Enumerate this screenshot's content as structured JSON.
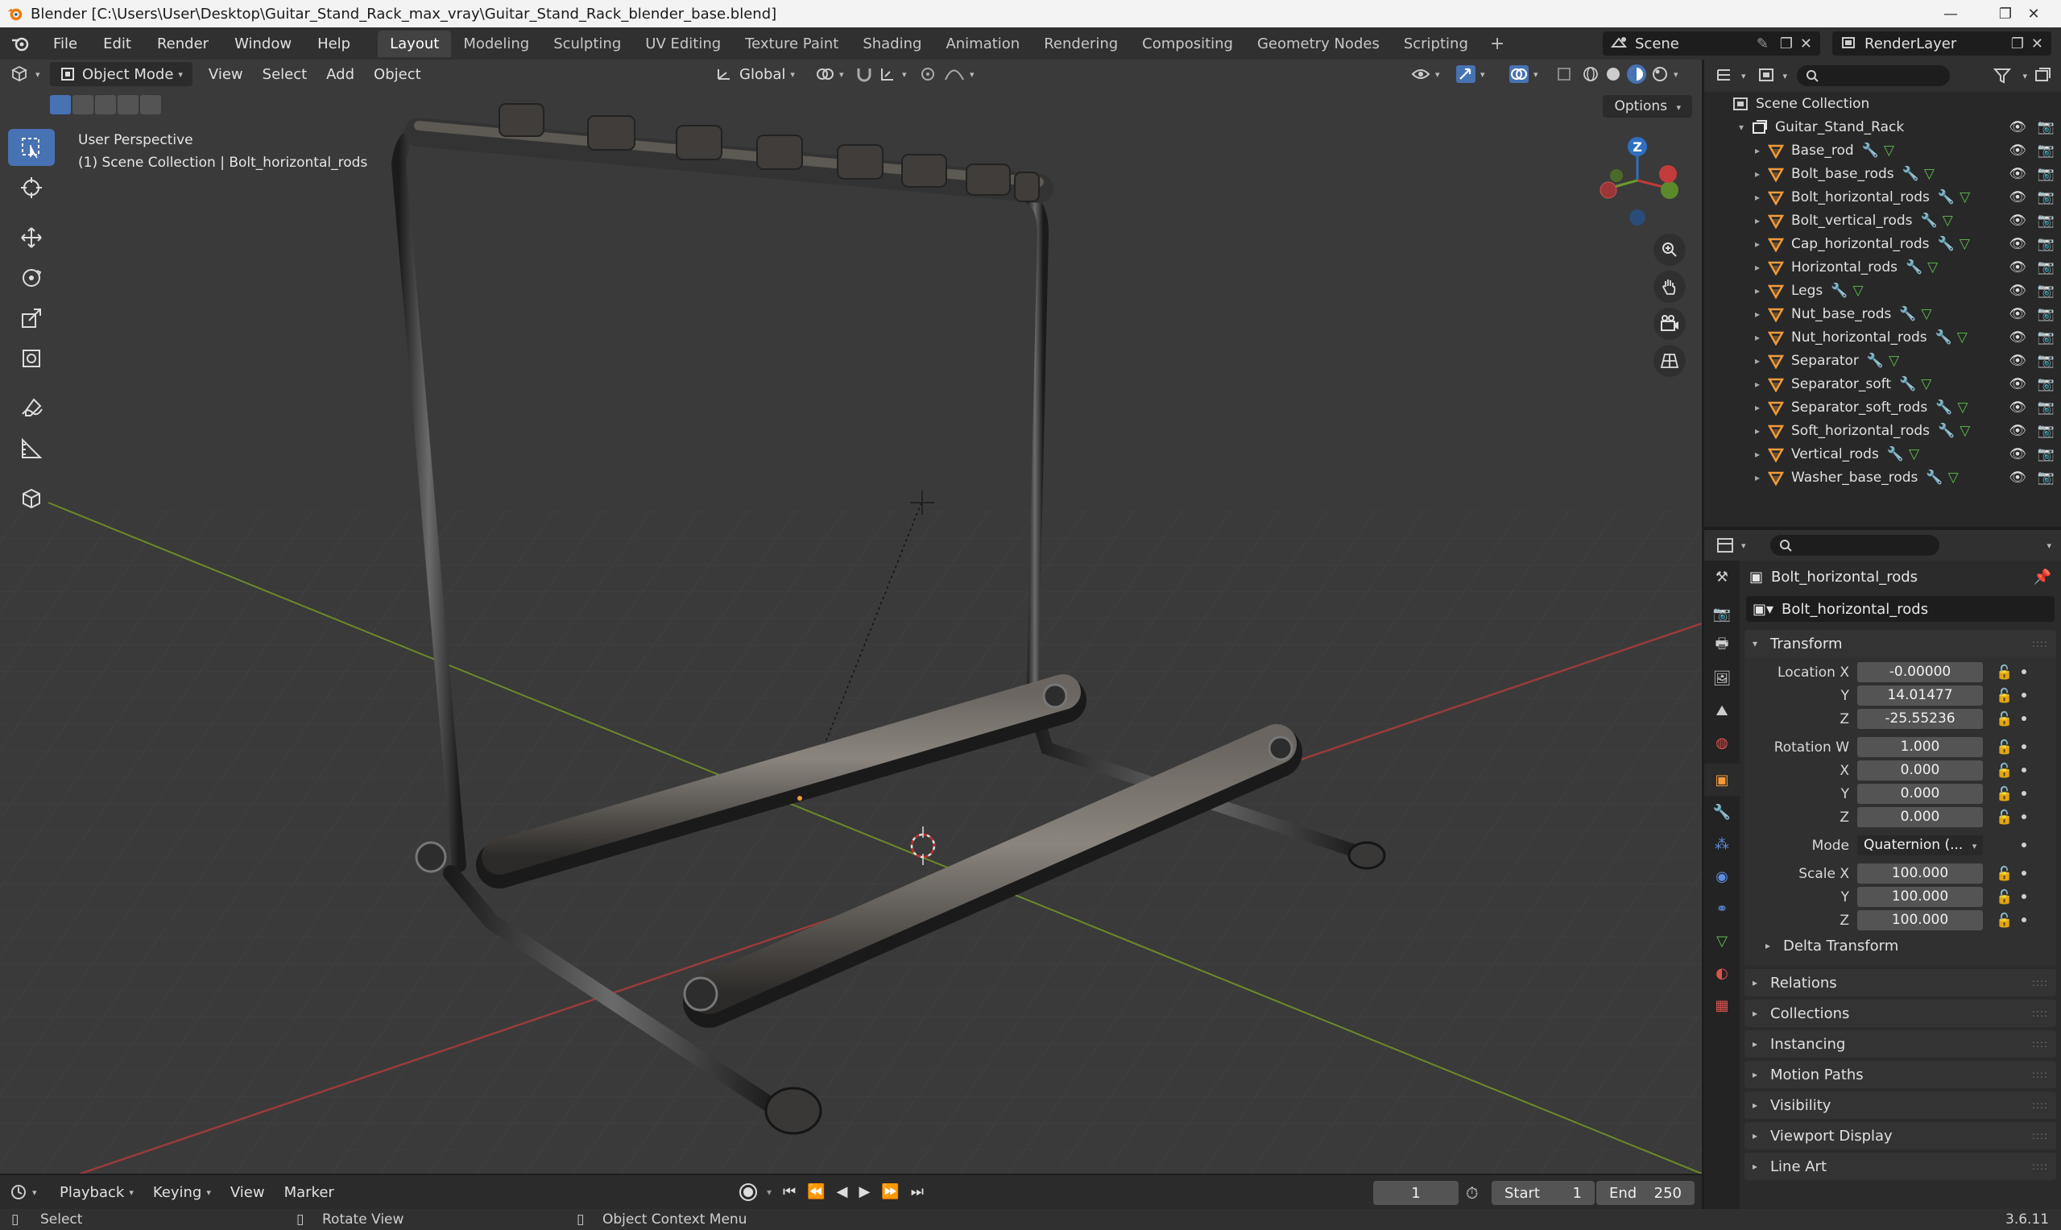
{
  "window": {
    "title": "Blender [C:\\Users\\User\\Desktop\\Guitar_Stand_Rack_max_vray\\Guitar_Stand_Rack_blender_base.blend]",
    "minimize": "—",
    "maximize": "❐",
    "close": "✕"
  },
  "menu": [
    "File",
    "Edit",
    "Render",
    "Window",
    "Help"
  ],
  "workspaces": [
    "Layout",
    "Modeling",
    "Sculpting",
    "UV Editing",
    "Texture Paint",
    "Shading",
    "Animation",
    "Rendering",
    "Compositing",
    "Geometry Nodes",
    "Scripting"
  ],
  "scene_name": "Scene",
  "view_layer": "RenderLayer",
  "viewport": {
    "mode": "Object Mode",
    "menus": [
      "View",
      "Select",
      "Add",
      "Object"
    ],
    "transform_orientation": "Global",
    "options_label": "Options",
    "info_line1": "User Perspective",
    "info_line2": "(1) Scene Collection | Bolt_horizontal_rods"
  },
  "gizmo": {
    "z": "Z"
  },
  "outliner": {
    "root": "Scene Collection",
    "collection": "Guitar_Stand_Rack",
    "objects": [
      "Base_rod",
      "Bolt_base_rods",
      "Bolt_horizontal_rods",
      "Bolt_vertical_rods",
      "Cap_horizontal_rods",
      "Horizontal_rods",
      "Legs",
      "Nut_base_rods",
      "Nut_horizontal_rods",
      "Separator",
      "Separator_soft",
      "Separator_soft_rods",
      "Soft_horizontal_rods",
      "Vertical_rods",
      "Washer_base_rods"
    ]
  },
  "properties": {
    "object_name": "Bolt_horizontal_rods",
    "data_name": "Bolt_horizontal_rods",
    "transform_label": "Transform",
    "location_label": "Location X",
    "location": [
      "-0.00000",
      "14.01477",
      "-25.55236"
    ],
    "rotation_label": "Rotation W",
    "rotation": [
      "1.000",
      "0.000",
      "0.000",
      "0.000"
    ],
    "mode_label": "Mode",
    "mode_value": "Quaternion (...",
    "scale_label": "Scale X",
    "scale": [
      "100.000",
      "100.000",
      "100.000"
    ],
    "axis_y": "Y",
    "axis_z": "Z",
    "axis_x": "X",
    "delta_transform": "Delta Transform",
    "panels": [
      "Relations",
      "Collections",
      "Instancing",
      "Motion Paths",
      "Visibility",
      "Viewport Display",
      "Line Art"
    ]
  },
  "timeline": {
    "menus": [
      "Playback",
      "Keying",
      "View",
      "Marker"
    ],
    "current_frame": "1",
    "start_label": "Start",
    "start": "1",
    "end_label": "End",
    "end": "250"
  },
  "statusbar": {
    "select": "Select",
    "rotate": "Rotate View",
    "context": "Object Context Menu",
    "version": "3.6.11"
  },
  "colors": {
    "accent": "#4772b3",
    "object_orange": "#f29b3b",
    "axis_red": "#a03c3c",
    "axis_green": "#6d8a2c"
  }
}
